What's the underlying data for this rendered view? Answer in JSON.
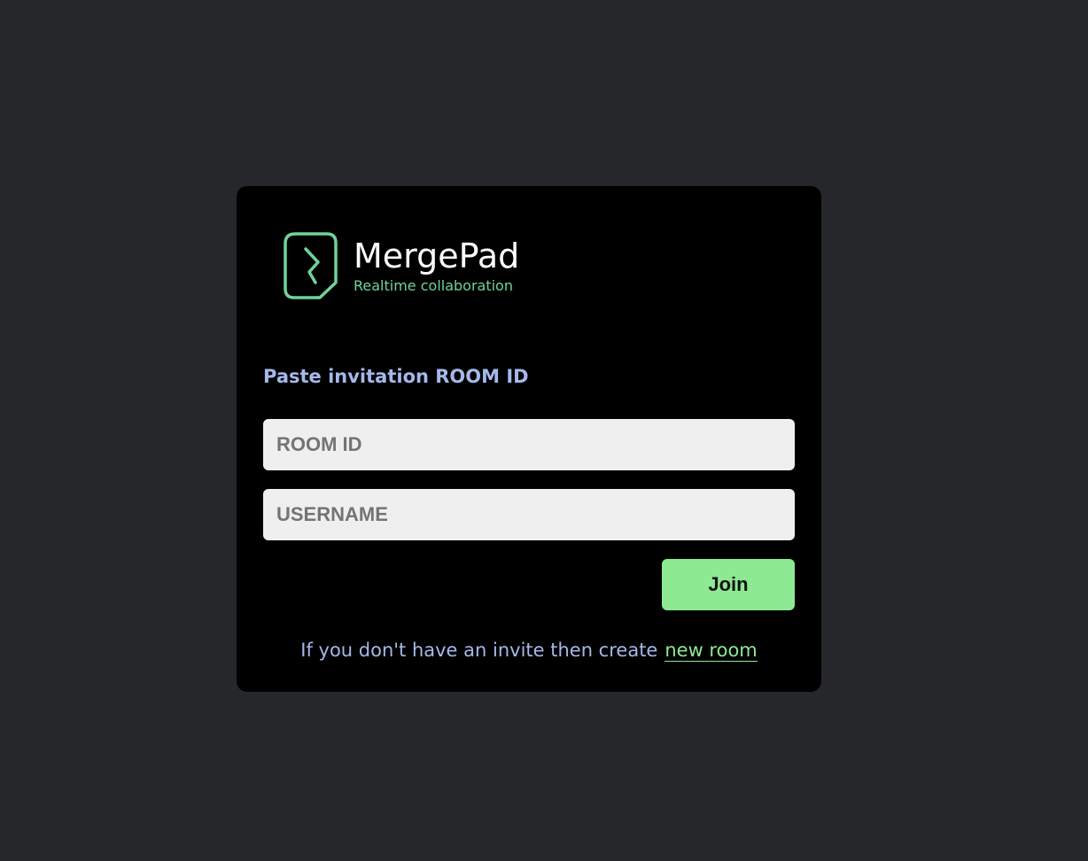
{
  "brand": {
    "name": "MergePad",
    "tagline": "Realtime collaboration",
    "icon": "mergepad-logo-icon",
    "accent_color": "#6fd39c"
  },
  "form": {
    "heading": "Paste invitation ROOM ID",
    "room_id": {
      "placeholder": "ROOM ID",
      "value": ""
    },
    "username": {
      "placeholder": "USERNAME",
      "value": ""
    },
    "join_label": "Join",
    "join_color": "#8de992"
  },
  "footer": {
    "text": "If you don't have an invite then create",
    "link_label": "new room"
  },
  "colors": {
    "page_background": "#26272b",
    "card_background": "#000000",
    "label_color": "#a5b8ea"
  }
}
